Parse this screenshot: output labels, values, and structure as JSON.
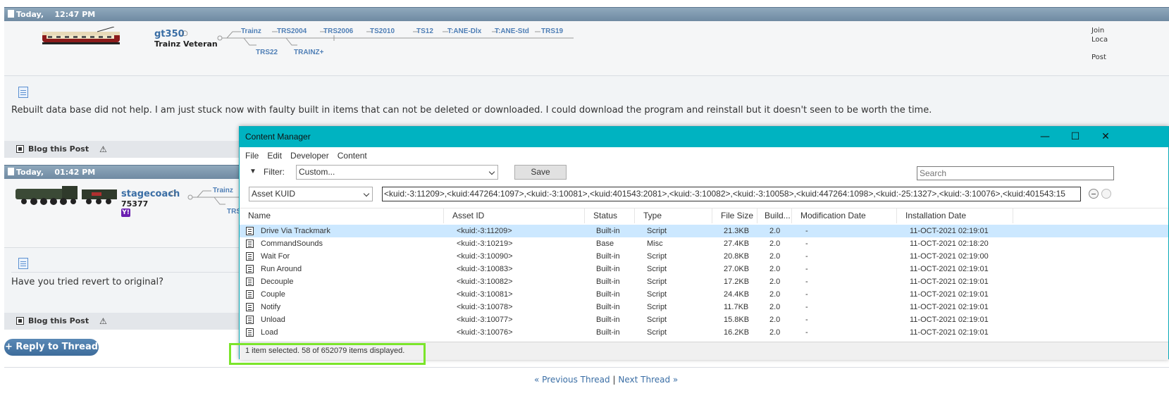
{
  "post1": {
    "date_label": "Today,",
    "time": "12:47 PM",
    "username": "gt350",
    "user_title": "Trainz Veteran",
    "versions_row1": [
      "Trainz",
      "TRS2004",
      "TRS2006",
      "TS2010",
      "TS12",
      "T:ANE-Dlx",
      "T:ANE-Std",
      "TRS19"
    ],
    "versions_row2": [
      "TRS22",
      "TRAINZ+"
    ],
    "side_labels": [
      "Join",
      "Loca",
      "Post"
    ],
    "text": "Rebuilt data base did not help. I am just stuck now with faulty built in items that can not be deleted or downloaded. I could download the program and reinstall but it doesn't seen to be worth the time.",
    "blog_label": "Blog this Post"
  },
  "post2": {
    "date_label": "Today,",
    "time": "01:42 PM",
    "username": "stagecoach",
    "user_number": "75377",
    "version_partial": "Trainz",
    "version_partial2": "TRS",
    "text": "Have you tried revert to original?",
    "blog_label": "Blog this Post"
  },
  "reply_button": "+ Reply to Thread",
  "nav": {
    "prev": "« Previous Thread",
    "sep": "|",
    "next": "Next Thread »"
  },
  "cm": {
    "title": "Content Manager",
    "menu": [
      "File",
      "Edit",
      "Developer",
      "Content"
    ],
    "filter_label": "Filter:",
    "filter_value": "Custom...",
    "save": "Save",
    "search_placeholder": "Search",
    "field_select": "Asset KUID",
    "kuid_query": "<kuid:-3:11209>,<kuid:447264:1097>,<kuid:-3:10081>,<kuid:401543:2081>,<kuid:-3:10082>,<kuid:-3:10058>,<kuid:447264:1098>,<kuid:-25:1327>,<kuid:-3:10076>,<kuid:401543:15",
    "columns": [
      "Name",
      "Asset ID",
      "Status",
      "Type",
      "File Size",
      "Build...",
      "Modification Date",
      "Installation Date"
    ],
    "rows": [
      {
        "name": "Drive Via Trackmark",
        "id": "<kuid:-3:11209>",
        "status": "Built-in",
        "type": "Script",
        "size": "21.3KB",
        "build": "2.0",
        "mod": "-",
        "inst": "11-OCT-2021 02:19:01"
      },
      {
        "name": "CommandSounds",
        "id": "<kuid:-3:10219>",
        "status": "Base",
        "type": "Misc",
        "size": "27.4KB",
        "build": "2.0",
        "mod": "-",
        "inst": "11-OCT-2021 02:18:20"
      },
      {
        "name": "Wait For",
        "id": "<kuid:-3:10090>",
        "status": "Built-in",
        "type": "Script",
        "size": "20.8KB",
        "build": "2.0",
        "mod": "-",
        "inst": "11-OCT-2021 02:19:00"
      },
      {
        "name": "Run Around",
        "id": "<kuid:-3:10083>",
        "status": "Built-in",
        "type": "Script",
        "size": "27.0KB",
        "build": "2.0",
        "mod": "-",
        "inst": "11-OCT-2021 02:19:01"
      },
      {
        "name": "Decouple",
        "id": "<kuid:-3:10082>",
        "status": "Built-in",
        "type": "Script",
        "size": "17.2KB",
        "build": "2.0",
        "mod": "-",
        "inst": "11-OCT-2021 02:19:01"
      },
      {
        "name": "Couple",
        "id": "<kuid:-3:10081>",
        "status": "Built-in",
        "type": "Script",
        "size": "24.4KB",
        "build": "2.0",
        "mod": "-",
        "inst": "11-OCT-2021 02:19:01"
      },
      {
        "name": "Notify",
        "id": "<kuid:-3:10078>",
        "status": "Built-in",
        "type": "Script",
        "size": "11.7KB",
        "build": "2.0",
        "mod": "-",
        "inst": "11-OCT-2021 02:19:01"
      },
      {
        "name": "Unload",
        "id": "<kuid:-3:10077>",
        "status": "Built-in",
        "type": "Script",
        "size": "15.8KB",
        "build": "2.0",
        "mod": "-",
        "inst": "11-OCT-2021 02:19:01"
      },
      {
        "name": "Load",
        "id": "<kuid:-3:10076>",
        "status": "Built-in",
        "type": "Script",
        "size": "16.2KB",
        "build": "2.0",
        "mod": "-",
        "inst": "11-OCT-2021 02:19:01"
      }
    ],
    "status_text": "1 item selected. 58 of 652079 items displayed."
  },
  "colors": {
    "highlight_box": "#7be52b",
    "titlebar": "#00b3c1",
    "selected_row": "#cce8ff"
  }
}
